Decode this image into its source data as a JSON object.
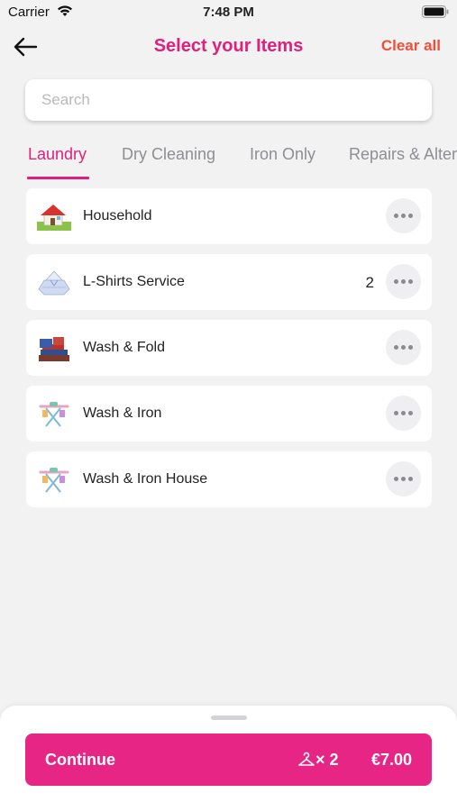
{
  "status_bar": {
    "carrier": "Carrier",
    "time": "7:48 PM"
  },
  "header": {
    "title": "Select your Items",
    "clear_all": "Clear all",
    "back_icon": "arrow-left-icon"
  },
  "search": {
    "placeholder": "Search",
    "value": ""
  },
  "tabs": [
    {
      "label": "Laundry",
      "active": true
    },
    {
      "label": "Dry Cleaning",
      "active": false
    },
    {
      "label": "Iron Only",
      "active": false
    },
    {
      "label": "Repairs & Alter",
      "active": false
    }
  ],
  "items": [
    {
      "label": "Household",
      "count": "",
      "icon": "house-icon"
    },
    {
      "label": "L-Shirts Service",
      "count": "2",
      "icon": "folded-shirt-icon"
    },
    {
      "label": "Wash & Fold",
      "count": "",
      "icon": "folded-clothes-icon"
    },
    {
      "label": "Wash & Iron",
      "count": "",
      "icon": "ironing-board-icon"
    },
    {
      "label": "Wash & Iron House",
      "count": "",
      "icon": "ironing-board-icon"
    }
  ],
  "footer": {
    "continue_label": "Continue",
    "quantity": "× 2",
    "total": "€7.00",
    "hanger_icon": "hanger-icon"
  },
  "colors": {
    "accent": "#e0207c",
    "button": "#e62585",
    "clear": "#ef4f3a",
    "background": "#f2f2f3"
  }
}
